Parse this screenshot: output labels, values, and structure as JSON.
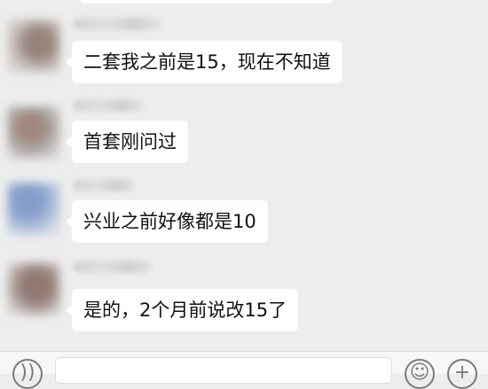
{
  "messages": [
    {
      "sender_visible": false,
      "text": "二套我之前是15，现在不知道"
    },
    {
      "sender_visible": false,
      "text": "首套刚问过"
    },
    {
      "sender_visible": false,
      "text": "兴业之前好像都是10"
    },
    {
      "sender_visible": false,
      "text": "是的，2个月前说改15了"
    }
  ],
  "input_bar": {
    "voice_icon": "voice-icon",
    "emoji_icon": "emoji-icon",
    "plus_icon": "plus-icon",
    "input_value": ""
  },
  "colors": {
    "background": "#ededed",
    "bubble": "#ffffff",
    "text": "#111111",
    "input_bar": "#f7f7f7"
  }
}
